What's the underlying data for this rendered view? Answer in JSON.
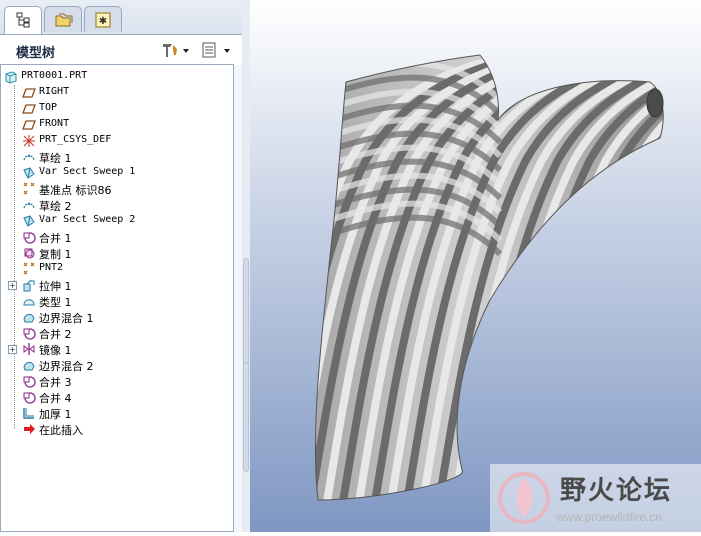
{
  "panel": {
    "title": "模型树",
    "tabs": [
      {
        "name": "model-tree",
        "icon": "model-tree-tab-icon"
      },
      {
        "name": "folder-browser",
        "icon": "folder-icon"
      },
      {
        "name": "favorites",
        "icon": "star-icon"
      }
    ]
  },
  "tree": {
    "root": "PRT0001.PRT",
    "items": [
      {
        "label": "RIGHT",
        "icon": "datum-plane-icon",
        "cjk": false,
        "expand": false
      },
      {
        "label": "TOP",
        "icon": "datum-plane-icon",
        "cjk": false,
        "expand": false
      },
      {
        "label": "FRONT",
        "icon": "datum-plane-icon",
        "cjk": false,
        "expand": false
      },
      {
        "label": "PRT_CSYS_DEF",
        "icon": "csys-icon",
        "cjk": false,
        "expand": false
      },
      {
        "label": "草绘 1",
        "icon": "sketch-icon",
        "cjk": true,
        "expand": false
      },
      {
        "label": "Var Sect Sweep 1",
        "icon": "sweep-icon",
        "cjk": false,
        "expand": false
      },
      {
        "label": "基准点 标识86",
        "icon": "datum-point-icon",
        "cjk": true,
        "expand": false
      },
      {
        "label": "草绘 2",
        "icon": "sketch-icon",
        "cjk": true,
        "expand": false
      },
      {
        "label": "Var Sect Sweep 2",
        "icon": "sweep-icon",
        "cjk": false,
        "expand": false
      },
      {
        "label": "合并 1",
        "icon": "merge-icon",
        "cjk": true,
        "expand": false
      },
      {
        "label": "复制 1",
        "icon": "copy-icon",
        "cjk": true,
        "expand": false
      },
      {
        "label": "PNT2",
        "icon": "datum-point-icon",
        "cjk": false,
        "expand": false
      },
      {
        "label": "拉伸 1",
        "icon": "extrude-icon",
        "cjk": true,
        "expand": true
      },
      {
        "label": "类型 1",
        "icon": "style-icon",
        "cjk": true,
        "expand": false
      },
      {
        "label": "边界混合 1",
        "icon": "boundary-blend-icon",
        "cjk": true,
        "expand": false
      },
      {
        "label": "合并 2",
        "icon": "merge-icon",
        "cjk": true,
        "expand": false
      },
      {
        "label": "镜像 1",
        "icon": "mirror-icon",
        "cjk": true,
        "expand": true
      },
      {
        "label": "边界混合 2",
        "icon": "boundary-blend-icon",
        "cjk": true,
        "expand": false
      },
      {
        "label": "合并 3",
        "icon": "merge-icon",
        "cjk": true,
        "expand": false
      },
      {
        "label": "合并 4",
        "icon": "merge-icon",
        "cjk": true,
        "expand": false
      },
      {
        "label": "加厚 1",
        "icon": "thicken-icon",
        "cjk": true,
        "expand": false
      },
      {
        "label": "在此插入",
        "icon": "insert-arrow-icon",
        "cjk": true,
        "expand": false
      }
    ]
  },
  "watermark": {
    "title": "野火论坛",
    "url": "www.proewildfire.cn"
  },
  "colors": {
    "tree_icon": "#8b2a8b",
    "insert_arrow": "#e01b1b",
    "stripe_dark": "#6b6b6b",
    "stripe_light": "#e8e8e8"
  }
}
